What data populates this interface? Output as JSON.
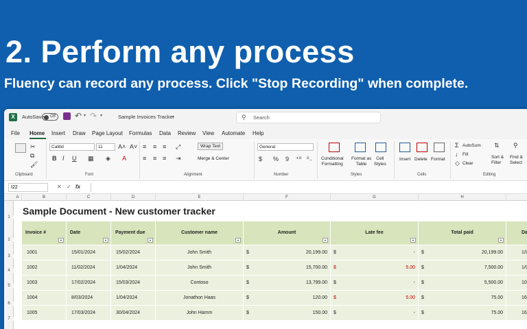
{
  "banner": {
    "headline": "2. Perform any process",
    "subline": "Fluency can record any process. Click \"Stop Recording\" when complete."
  },
  "titlebar": {
    "app_icon": "excel-icon",
    "autosave_label": "AutoSave",
    "autosave_state": "Off",
    "doc_title": "Sample Invoices Tracker",
    "search_placeholder": "Search"
  },
  "menu": {
    "tabs": [
      "File",
      "Home",
      "Insert",
      "Draw",
      "Page Layout",
      "Formulas",
      "Data",
      "Review",
      "View",
      "Automate",
      "Help"
    ],
    "active": "Home"
  },
  "ribbon": {
    "clipboard_label": "Clipboard",
    "font_name": "Calibri",
    "font_size": "11",
    "font_label": "Font",
    "bold": "B",
    "italic": "I",
    "underline": "U",
    "wrap_text": "Wrap Text",
    "merge_center": "Merge & Center",
    "alignment_label": "Alignment",
    "number_format": "General",
    "number_label": "Number",
    "currency": "$",
    "percent": "%",
    "comma": "9",
    "conditional_formatting": [
      "Conditional",
      "Formatting"
    ],
    "format_as_table": [
      "Format as",
      "Table"
    ],
    "cell_styles": [
      "Cell",
      "Styles"
    ],
    "styles_label": "Styles",
    "insert": "Insert",
    "delete": "Delete",
    "format": "Format",
    "cells_label": "Cells",
    "autosum": "AutoSum",
    "fill": "Fill",
    "clear": "Clear",
    "sort_filter": [
      "Sort &",
      "Filter"
    ],
    "find_select": [
      "Find &",
      "Select"
    ],
    "editing_label": "Editing"
  },
  "formula_bar": {
    "name_box": "I22",
    "fx": "fx",
    "content": ""
  },
  "columns": [
    "A",
    "B",
    "C",
    "D",
    "E",
    "F",
    "G",
    "H"
  ],
  "rows": [
    "1",
    "2",
    "3",
    "4",
    "5",
    "6",
    "7"
  ],
  "sheet": {
    "title": "Sample Document - New customer tracker",
    "headers": [
      "Invoice #",
      "Date",
      "Payment due",
      "Customer name",
      "Amount",
      "Late fee",
      "Total paid",
      "Da"
    ],
    "data": [
      {
        "invoice": "1001",
        "date": "15/01/2024",
        "due": "15/02/2024",
        "customer": "John Smith",
        "amount": "20,199.00",
        "late_fee": "-",
        "total": "20,199.00",
        "extra": "1/0"
      },
      {
        "invoice": "1002",
        "date": "11/02/2024",
        "due": "1/04/2024",
        "customer": "John Smith",
        "amount": "15,700.00",
        "late_fee": "5.00",
        "total": "7,500.00",
        "extra": "1/0"
      },
      {
        "invoice": "1003",
        "date": "17/02/2024",
        "due": "15/03/2024",
        "customer": "Contoso",
        "amount": "13,799.00",
        "late_fee": "-",
        "total": "5,500.00",
        "extra": "10/"
      },
      {
        "invoice": "1004",
        "date": "8/03/2024",
        "due": "1/04/2024",
        "customer": "Jonathon Haas",
        "amount": "120.00",
        "late_fee": "5.00",
        "total": "75.00",
        "extra": "16/"
      },
      {
        "invoice": "1005",
        "date": "17/03/2024",
        "due": "30/04/2024",
        "customer": "John Hamm",
        "amount": "150.00",
        "late_fee": "-",
        "total": "75.00",
        "extra": "16/"
      }
    ],
    "currency_symbol": "$"
  }
}
